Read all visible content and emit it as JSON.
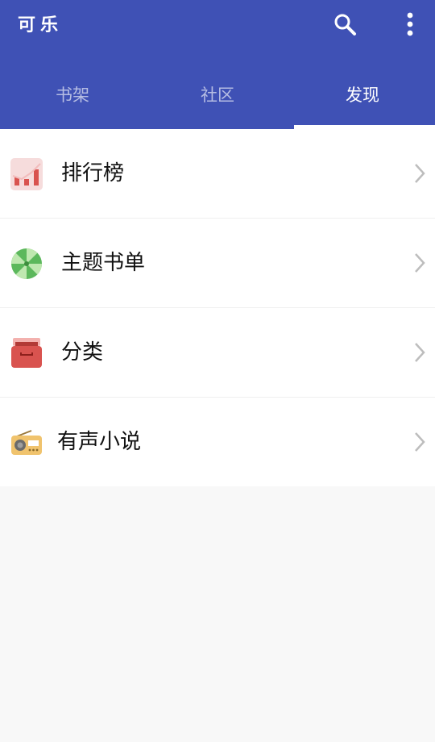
{
  "app": {
    "title": "可乐"
  },
  "toolbar": {
    "search_icon": "search-icon",
    "more_icon": "more-vert-icon"
  },
  "tabs": [
    {
      "label": "书架",
      "active": false
    },
    {
      "label": "社区",
      "active": false
    },
    {
      "label": "发现",
      "active": true
    }
  ],
  "colors": {
    "accent": "#3f51b5",
    "tab_indicator": "#ffffff",
    "background": "#f8f8f8"
  },
  "menu": [
    {
      "label": "排行榜",
      "icon": "ranking-chart-icon"
    },
    {
      "label": "主题书单",
      "icon": "book-list-candy-icon"
    },
    {
      "label": "分类",
      "icon": "category-box-icon"
    },
    {
      "label": "有声小说",
      "icon": "radio-icon"
    }
  ]
}
